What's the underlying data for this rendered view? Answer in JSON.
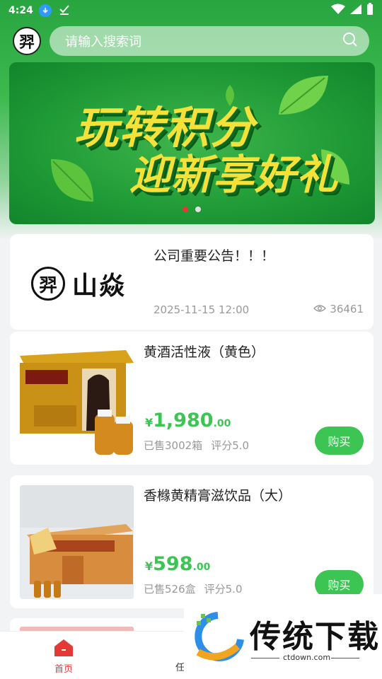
{
  "status_bar": {
    "time": "4:24"
  },
  "search": {
    "placeholder": "请输入搜索词"
  },
  "header": {
    "logo_glyph": "羿"
  },
  "banner": {
    "title_line1": "玩转积分",
    "title_line2": "迎新享好礼",
    "slides": 2,
    "active_slide": 1
  },
  "notice": {
    "brand_seal": "羿",
    "brand_name": "山焱",
    "title": "公司重要公告！！！",
    "date": "2025-11-15 12:00",
    "views": "36461"
  },
  "products": [
    {
      "title": "黄酒活性液（黄色）",
      "price_symbol": "¥",
      "price_int": "1,980",
      "price_dec": ".00",
      "sold": "已售3002箱",
      "rating": "评分5.0",
      "buy_label": "购买"
    },
    {
      "title": "香橼黄精膏滋饮品（大）",
      "price_symbol": "¥",
      "price_int": "598",
      "price_dec": ".00",
      "sold": "已售526盒",
      "rating": "评分5.0",
      "buy_label": "购买"
    }
  ],
  "bottom_nav": {
    "home_label": "首页",
    "second_label_partial": "任"
  },
  "watermark": {
    "text": "传统下载",
    "url": "ctdown.com"
  },
  "colors": {
    "brand_green": "#3cc553",
    "active_red": "#e53935",
    "banner_text": "#f4e23a"
  }
}
